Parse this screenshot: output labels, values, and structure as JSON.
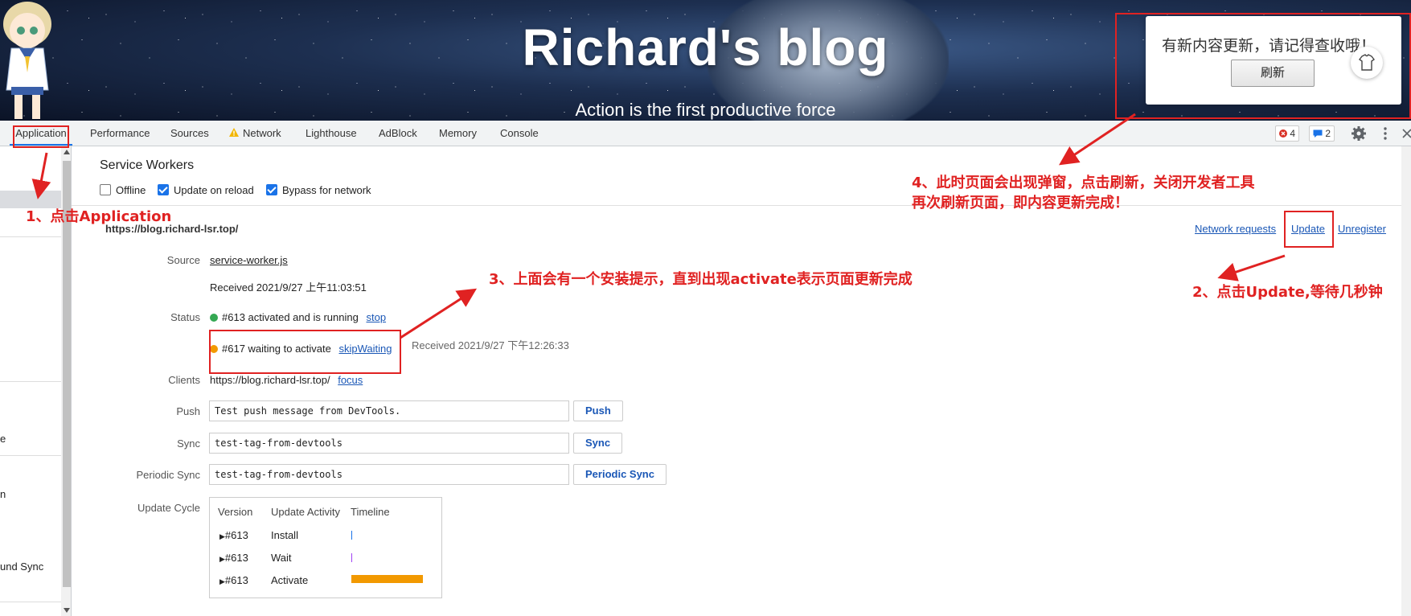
{
  "banner": {
    "title": "Richard's blog",
    "subtitle": "Action is the first productive force",
    "toast_message": "有新内容更新，请记得查收哦！",
    "toast_button": "刷新"
  },
  "devtools_tabs": [
    "Application",
    "Performance",
    "Sources",
    "Network",
    "Lighthouse",
    "AdBlock",
    "Memory",
    "Console"
  ],
  "toolbar": {
    "errors_count": "4",
    "messages_count": "2"
  },
  "sidebar": {
    "fragments": [
      "e",
      "n",
      "und Sync"
    ]
  },
  "service_workers": {
    "section_title": "Service Workers",
    "offline_label": "Offline",
    "update_on_reload_label": "Update on reload",
    "bypass_label": "Bypass for network",
    "scope_url": "https://blog.richard-lsr.top/",
    "network_requests_link": "Network requests",
    "update_link": "Update",
    "unregister_link": "Unregister",
    "source_label": "Source",
    "source_file": "service-worker.js",
    "received": "Received 2021/9/27 上午11:03:51",
    "status_label": "Status",
    "status_active": "#613 activated and is running",
    "stop_link": "stop",
    "status_waiting": "#617 waiting to activate",
    "skip_waiting_link": "skipWaiting",
    "waiting_received": "Received 2021/9/27 下午12:26:33",
    "clients_label": "Clients",
    "client_url": "https://blog.richard-lsr.top/",
    "focus_link": "focus",
    "push_label": "Push",
    "push_value": "Test push message from DevTools.",
    "push_button": "Push",
    "sync_label": "Sync",
    "sync_value": "test-tag-from-devtools",
    "sync_button": "Sync",
    "periodic_label": "Periodic Sync",
    "periodic_value": "test-tag-from-devtools",
    "periodic_button": "Periodic Sync",
    "update_cycle_label": "Update Cycle",
    "cycle_headers": [
      "Version",
      "Update Activity",
      "Timeline"
    ],
    "cycle_rows": [
      {
        "version": "#613",
        "activity": "Install"
      },
      {
        "version": "#613",
        "activity": "Wait"
      },
      {
        "version": "#613",
        "activity": "Activate"
      }
    ]
  },
  "annotations": {
    "step1": "1、点击Application",
    "step2": "2、点击Update,等待几秒钟",
    "step3": "3、上面会有一个安装提示，直到出现activate表示页面更新完成",
    "step4_line1": "4、此时页面会出现弹窗，点击刷新，关闭开发者工具",
    "step4_line2": "再次刷新页面，即内容更新完成！"
  },
  "colors": {
    "annotation_red": "#e02222",
    "link_blue": "#1a57b6",
    "status_green": "#34a853",
    "status_orange": "#f29900",
    "timeline_bar": "#f29900",
    "tab_active_underline": "#1a73e8"
  }
}
